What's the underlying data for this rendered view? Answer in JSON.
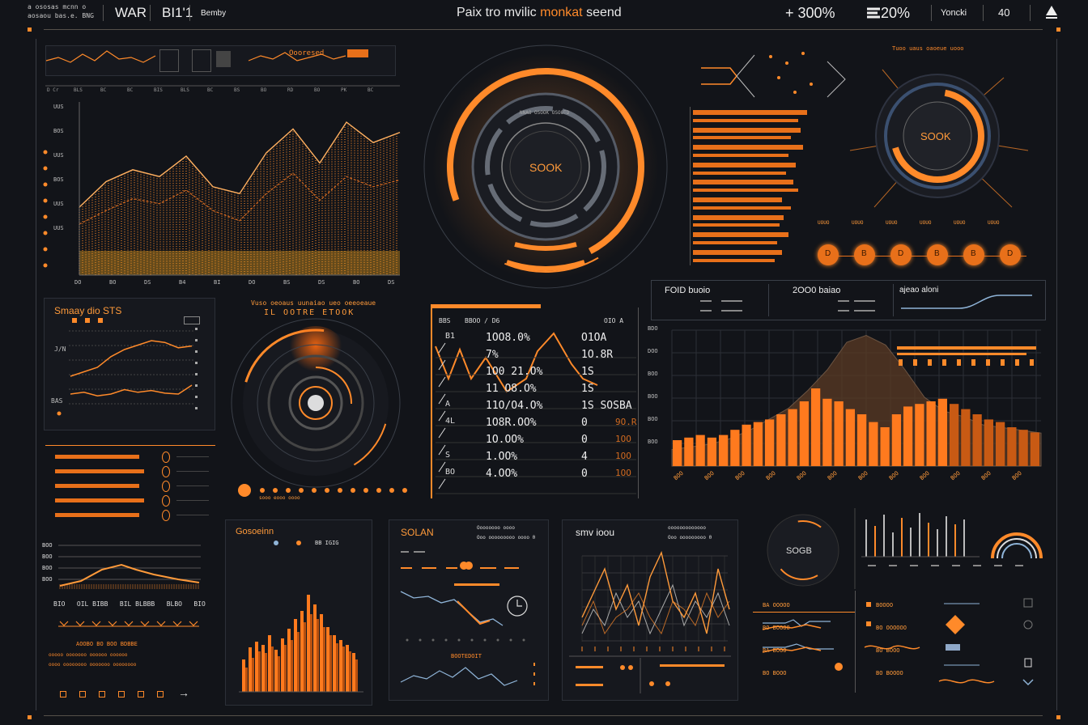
{
  "topbar": {
    "brand_line1": "a ososas mcnn o",
    "brand_line2": "aosaou bas.e. BNG",
    "tab1": "WAR",
    "tab2": "BI1'1",
    "tab3": "Bemby",
    "title_part1": "Paix tro mvilic",
    "title_highlight": "monkat",
    "title_part2": "seend",
    "stat1": "+ 300%",
    "stat2": "20%",
    "user": "Yoncki",
    "count": "40"
  },
  "main_chart": {
    "y_labels": [
      "UUS",
      "BOS",
      "UUS",
      "BOS",
      "UUS",
      "UUS"
    ],
    "x_labels": [
      "DO",
      "BO",
      "DS",
      "B4",
      "BI",
      "DO",
      "BS",
      "DS",
      "BO",
      "DS"
    ],
    "line_values": [
      40,
      55,
      62,
      58,
      70,
      52,
      48,
      72,
      86,
      66,
      90,
      78,
      84
    ],
    "line2_values": [
      30,
      38,
      45,
      42,
      50,
      38,
      32,
      48,
      60,
      44,
      58,
      52,
      56
    ],
    "header_labels": [
      "D Cr",
      "BLS",
      "BC",
      "BC",
      "BIS",
      "BLS",
      "BC",
      "BS",
      "BO",
      "RD",
      "BO",
      "PK",
      "BC"
    ]
  },
  "top_mini": {
    "label": "Oooresed"
  },
  "center_gauge": {
    "label": "SOOK",
    "ring_text": "NNAO OSOOK OSOOTD"
  },
  "right_gauge": {
    "label": "SOOK",
    "caption": "Tuoo uaus oaoeue uooo",
    "ticks": [
      "UOUO",
      "UOUO",
      "UOUO",
      "UOUO",
      "UOUO",
      "UOUO"
    ]
  },
  "bar_list": {
    "widths": [
      0.95,
      0.88,
      0.9,
      0.82,
      0.92,
      0.8,
      0.86,
      0.78,
      0.84,
      0.88,
      0.74,
      0.82,
      0.76,
      0.72,
      0.8,
      0.7,
      0.74,
      0.68
    ]
  },
  "circle_buttons": [
    "D",
    "B",
    "D",
    "B",
    "B",
    "D"
  ],
  "left_mini": {
    "title": "Smaay dio STS",
    "y_labels": [
      "J/N",
      "BAS"
    ],
    "series1": [
      40,
      45,
      50,
      62,
      70,
      75,
      80,
      78,
      72,
      74
    ],
    "series2": [
      20,
      22,
      18,
      20,
      25,
      22,
      24,
      21,
      20,
      30
    ]
  },
  "center_radar": {
    "title_line1": "Vuso oeoaus uunaiao ueo oeeoeaue",
    "title_line2": "IL OOTRE ETOOK",
    "dots_label": "sooo eooo oooo"
  },
  "table": {
    "header": [
      "BBS",
      "BBOO / D6",
      "OIO A"
    ],
    "rows": [
      [
        "B1",
        "1OO8.0%",
        "O1OA"
      ],
      [
        "",
        "7%",
        "1O.8R"
      ],
      [
        "",
        "1O0 21.O%",
        "1S"
      ],
      [
        "",
        "11 O8.O%",
        "1S"
      ],
      [
        "A",
        "11O/O4.O%",
        "1S SOSBA"
      ],
      [
        "4L",
        "1O8R.OO%",
        "0"
      ],
      [
        "",
        "1O.OO%",
        "0"
      ],
      [
        "S",
        "1.OO%",
        "4"
      ],
      [
        "BO",
        "4.OO%",
        "0"
      ]
    ],
    "row_extra": [
      "",
      "",
      "",
      "",
      "",
      "9O.R",
      "1OO",
      "1OO",
      "1OO"
    ]
  },
  "right_panel": {
    "header1": "FOID buoio",
    "header2": "2OO0 baiao",
    "header3": "ajeao aloni",
    "bar_values": [
      10,
      11,
      12,
      11,
      12,
      14,
      16,
      17,
      18,
      20,
      22,
      25,
      30,
      26,
      25,
      22,
      20,
      17,
      15,
      20,
      23,
      24,
      25,
      26,
      24,
      22,
      20,
      18,
      17,
      15,
      14,
      13
    ],
    "area_values": [
      12,
      14,
      16,
      20,
      26,
      34,
      42,
      55,
      70,
      90,
      95,
      88,
      70,
      50,
      40,
      36,
      30,
      28,
      26,
      24
    ],
    "y_labels": [
      "BDO",
      "DOO",
      "BOO",
      "BOO",
      "BOO",
      "BOO"
    ],
    "x_labels": [
      "BOO",
      "BOO",
      "BOO",
      "BOO",
      "BOO",
      "BOO",
      "BOO",
      "BOO",
      "BOO",
      "BOO",
      "BOO",
      "BOO"
    ]
  },
  "bottom_left_list": {
    "rows": 5
  },
  "bottom_left_chart": {
    "y_labels": [
      "BOO",
      "BOO",
      "BOO",
      "BOO"
    ],
    "x_labels": [
      "BIO",
      "OIL BIBB",
      "BIL BLBBB",
      "BLBO",
      "BIO"
    ],
    "caption1": "AOOBO BO BOO BDBBE",
    "caption2": "ooooo ooooooo oooooo oooooo",
    "caption3": "oooo oooooooo ooooooo oooooooo"
  },
  "sonar_panel": {
    "title": "SOLAN",
    "sub1": "Oooooooo oooo",
    "sub2": "Ooo ooooooooo oooo 0",
    "bottom": "BOOTEDOIT"
  },
  "gosh_panel": {
    "title": "Gosoeinn",
    "legend": "BB IGIG"
  },
  "sinv_panel": {
    "title": "smv ioou",
    "sub1": "ooooooooooooo",
    "sub2": "Ooo ooooooooo 0"
  },
  "bottom_gauge": {
    "label": "SOGB"
  },
  "bottom_right_list": {
    "rows_left": [
      "BA OOOOO",
      "BO BOOOO",
      "BA BOOO",
      "BO BOOO"
    ],
    "rows_right": [
      "BOOOO",
      "BO OOOOOO",
      "BO BOOO",
      "BO BOOOO"
    ]
  },
  "colors": {
    "bg": "#121419",
    "accent": "#ff8a2a",
    "accent_dark": "#d45a10",
    "line": "#3a3f48"
  }
}
